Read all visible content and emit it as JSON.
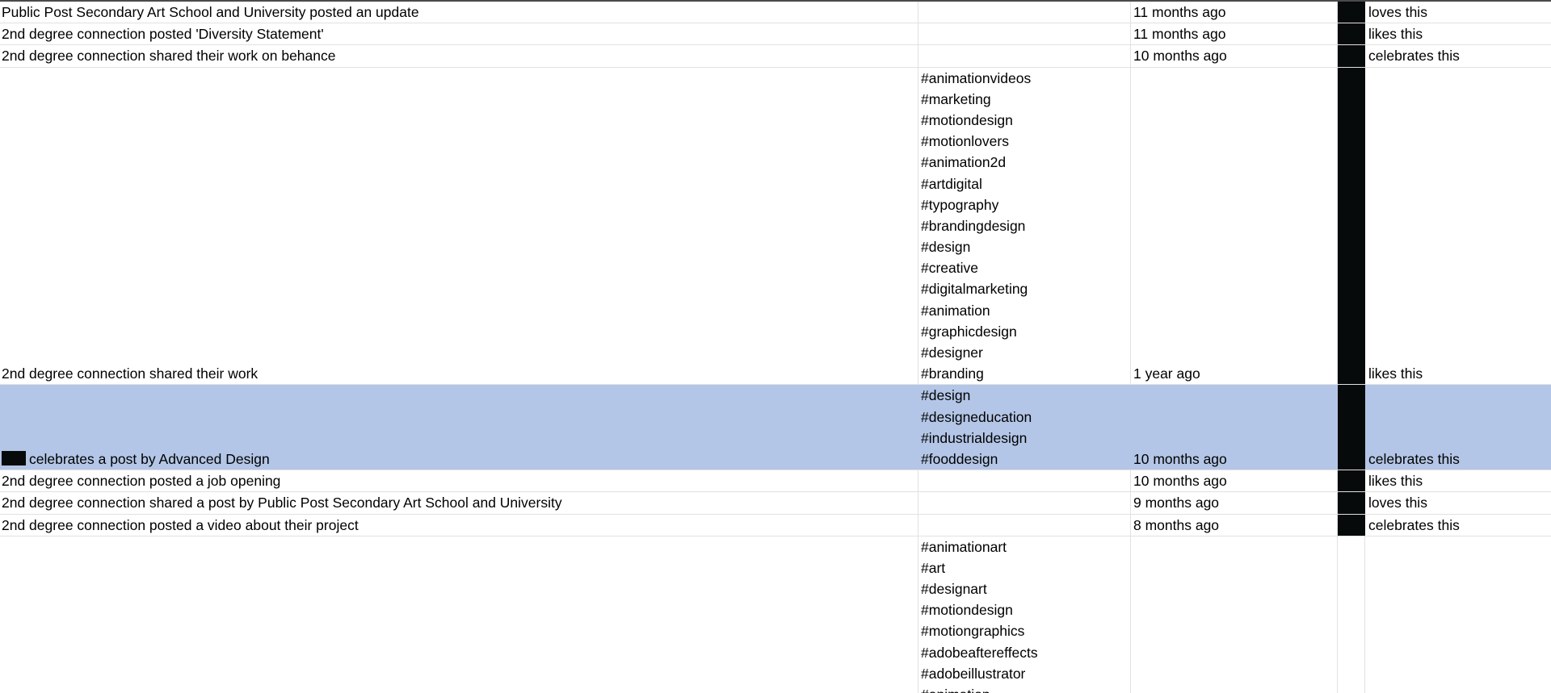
{
  "sheet": {
    "rows": [
      {
        "activity": "Public Post Secondary Art School and University posted an update",
        "hashtags": [],
        "time": "11 months ago",
        "reaction": "loves this"
      },
      {
        "activity": "2nd degree connection posted 'Diversity Statement'",
        "hashtags": [],
        "time": "11 months ago",
        "reaction": "likes this"
      },
      {
        "activity": "2nd degree connection shared their work on behance",
        "hashtags": [],
        "time": "10 months ago",
        "reaction": "celebrates this"
      },
      {
        "activity": "2nd degree connection shared their work",
        "hashtags": [
          "#animationvideos",
          "#marketing",
          "#motiondesign",
          "#motionlovers",
          "#animation2d",
          "#artdigital",
          "#typography",
          "#brandingdesign",
          "#design",
          "#creative",
          "#digitalmarketing",
          "#animation",
          "#graphicdesign",
          "#designer",
          "#branding"
        ],
        "time": "1 year ago",
        "reaction": "likes this"
      },
      {
        "activity": "celebrates a post by Advanced Design",
        "hashtags": [
          "#design",
          "#designeducation",
          "#industrialdesign",
          "#fooddesign"
        ],
        "time": "10 months ago",
        "reaction": "celebrates this"
      },
      {
        "activity": "2nd degree connection posted a job opening",
        "hashtags": [],
        "time": "10 months ago",
        "reaction": "likes this"
      },
      {
        "activity": "2nd degree connection shared a post by Public Post Secondary Art School and University",
        "hashtags": [],
        "time": "9 months ago",
        "reaction": "loves this"
      },
      {
        "activity": "2nd degree connection posted a video about their project",
        "hashtags": [],
        "time": "8 months ago",
        "reaction": "celebrates this"
      },
      {
        "activity": "",
        "hashtags": [
          "#animationart",
          "#art",
          "#designart",
          "#motiondesign",
          "#motiongraphics",
          "#adobeaftereffects",
          "#adobeillustrator",
          "#animation"
        ],
        "time": "",
        "reaction": ""
      }
    ]
  },
  "colors": {
    "selection": "#b4c6e7",
    "redaction": "#070a0b",
    "gridline": "#e1e1e1"
  }
}
